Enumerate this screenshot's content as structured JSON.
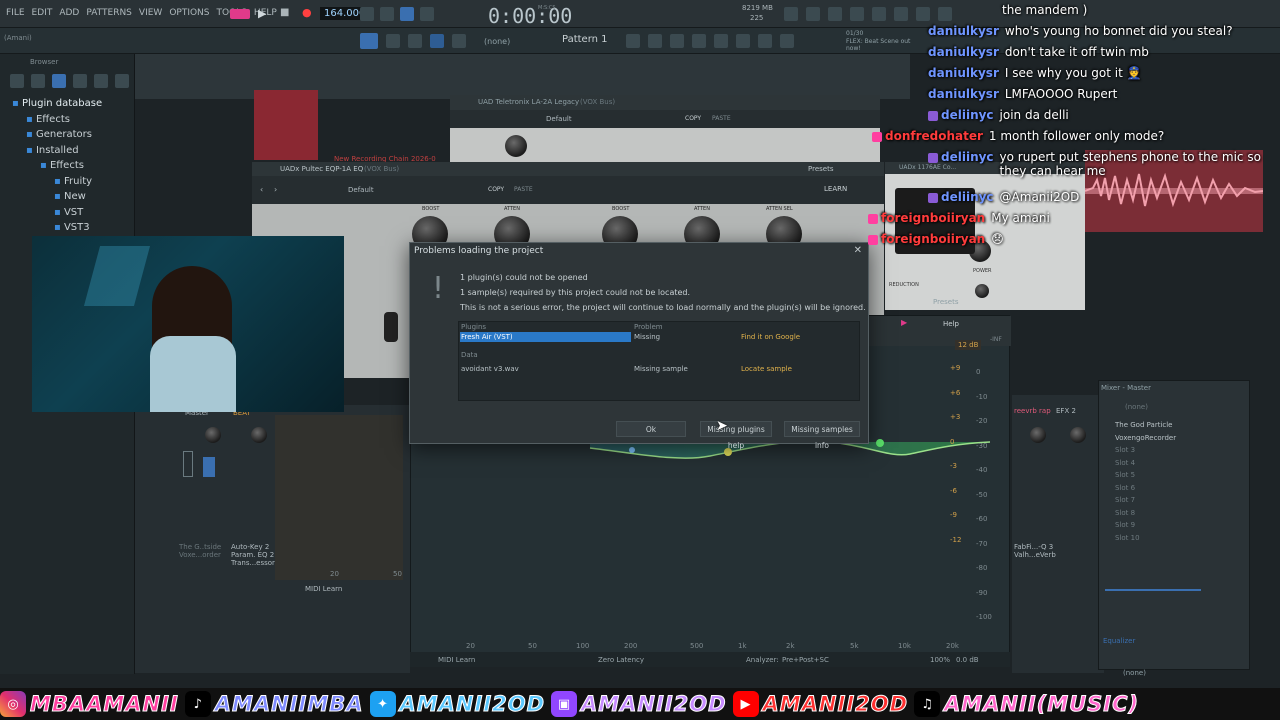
{
  "menu": [
    "FILE",
    "EDIT",
    "ADD",
    "PATTERNS",
    "VIEW",
    "OPTIONS",
    "TOOLS",
    "HELP"
  ],
  "transport": {
    "bpm": "164.000",
    "time": "0:00:00",
    "time_unit": "M:S:CS",
    "memory": "8219 MB",
    "cpu": "225"
  },
  "toolbar2": {
    "pattern_none": "(none)",
    "pattern": "Pattern 1",
    "news": "FLEX: Beat Scene out now!",
    "news_count": "01/30"
  },
  "browser": {
    "title": "Browser",
    "project": "(Amani)",
    "tree": [
      "Plugin database",
      "Effects",
      "Generators",
      "Installed",
      "Effects",
      "Fruity",
      "New",
      "VST",
      "VST3"
    ]
  },
  "teletronix": {
    "title": "UAD Teletronix LA-2A Legacy",
    "subtitle": "(VOX Bus)",
    "preset": "Default",
    "copy": "COPY",
    "paste": "PASTE"
  },
  "pultec": {
    "title": "UADx Pultec EQP-1A EQ",
    "subtitle": "(VOX Bus)",
    "preset": "Default",
    "copy": "COPY",
    "paste": "PASTE",
    "presets": "Presets",
    "learn": "LEARN",
    "labels": [
      "BOOST",
      "ATTEN",
      "BOOST",
      "ATTEN",
      "ATTEN SEL"
    ]
  },
  "uad1176": {
    "title": "UADx 1176AE Co...",
    "power": "POWER",
    "output": "OUTPUT",
    "reduction": "REDUCTION"
  },
  "rec_label": "New Recording Chain 2026-0",
  "dialog": {
    "title": "Problems loading the project",
    "line1": "1 plugin(s) could not be opened",
    "line2": "1 sample(s) required by this project could not be located.",
    "line3": "This is not a serious error, the project will continue to load normally and the plugin(s) will be ignored.",
    "col_plugins": "Plugins",
    "col_problem": "Problem",
    "col_data": "Data",
    "plugin_name": "Fresh Air (VST)",
    "plugin_problem": "Missing",
    "plugin_action": "Find it on Google",
    "sample_name": "avoidant v3.wav",
    "sample_problem": "Missing sample",
    "sample_action": "Locate sample",
    "ok": "Ok",
    "help1": "Missing plugins help",
    "help2": "Missing samples info"
  },
  "eq": {
    "presets": "Presets",
    "help": "Help",
    "gain_label": "12 dB",
    "db_left": [
      "+9",
      "+6",
      "+3",
      "0",
      "-3",
      "-6",
      "-9",
      "-12"
    ],
    "db_right": [
      "0",
      "-10",
      "-20",
      "-30",
      "-40",
      "-50",
      "-60",
      "-70",
      "-80",
      "-90",
      "-100"
    ],
    "inf": "-INF",
    "freqs": [
      "20",
      "50",
      "100",
      "200",
      "500",
      "1k",
      "2k",
      "5k",
      "10k",
      "20k"
    ],
    "midi_learn": "MIDI Learn",
    "latency": "Zero Latency",
    "analyzer": "Analyzer:",
    "analyzer_mode": "Pre+Post+SC",
    "zoom": "100%",
    "gain": "0.0 dB"
  },
  "mixer_strips": {
    "master": "Master",
    "beat": "BEAT",
    "s1": "The G..tside Voxe...order",
    "s2": "Auto-Key 2 Param. EQ 2 Trans...essor",
    "s3": "reevrb rap",
    "s4": "EFX 2",
    "s5": "FabFi...-Q 3 Valh...eVerb",
    "midi_learn": "MIDI Learn",
    "ruler20": "20",
    "ruler50": "50"
  },
  "mixer_panel": {
    "title": "Mixer - Master",
    "none_top": "(none)",
    "slots": [
      "The God Particle",
      "VoxengoRecorder",
      "Slot 3",
      "Slot 4",
      "Slot 5",
      "Slot 6",
      "Slot 7",
      "Slot 8",
      "Slot 9",
      "Slot 10"
    ],
    "equalizer": "Equalizer",
    "none_bottom": "(none)"
  },
  "chat": [
    {
      "user": "",
      "text": "the mandem )",
      "color": "#ffffff"
    },
    {
      "user": "daniulkysr",
      "text": "who's young ho bonnet did you steal?"
    },
    {
      "user": "daniulkysr",
      "text": "don't take it off twin mb"
    },
    {
      "user": "daniulkysr",
      "text": "I see why you got it 👮"
    },
    {
      "user": "daniulkysr",
      "text": "LMFAOOOO Rupert"
    },
    {
      "user": "deliinyc",
      "text": "join da delli"
    },
    {
      "user": "donfredohater",
      "text": "1 month follower only mode?"
    },
    {
      "user": "deliinyc",
      "text": "yo rupert put stephens phone to the mic so they can hear me"
    },
    {
      "user": "deliinyc",
      "text": "@Amanii2OD"
    },
    {
      "user": "foreignboiiryan",
      "text": "My amani"
    },
    {
      "user": "foreignboiiryan",
      "text": "😞"
    }
  ],
  "banner": [
    {
      "icon": "instagram-icon",
      "text": "MBAAMANII",
      "color": "#ff3fa0"
    },
    {
      "icon": "tiktok-icon",
      "text": "AMANIIMBA",
      "color": "#7e8aff"
    },
    {
      "icon": "twitter-icon",
      "text": "AMANII2OD",
      "color": "#5bc8ff"
    },
    {
      "icon": "twitch-icon",
      "text": "AMANII2OD",
      "color": "#c68bff"
    },
    {
      "icon": "youtube-icon",
      "text": "AMANII2OD",
      "color": "#ff3030"
    },
    {
      "icon": "music-icon",
      "text": "AMANII(MUSIC)",
      "color": "#ff66cc"
    }
  ]
}
